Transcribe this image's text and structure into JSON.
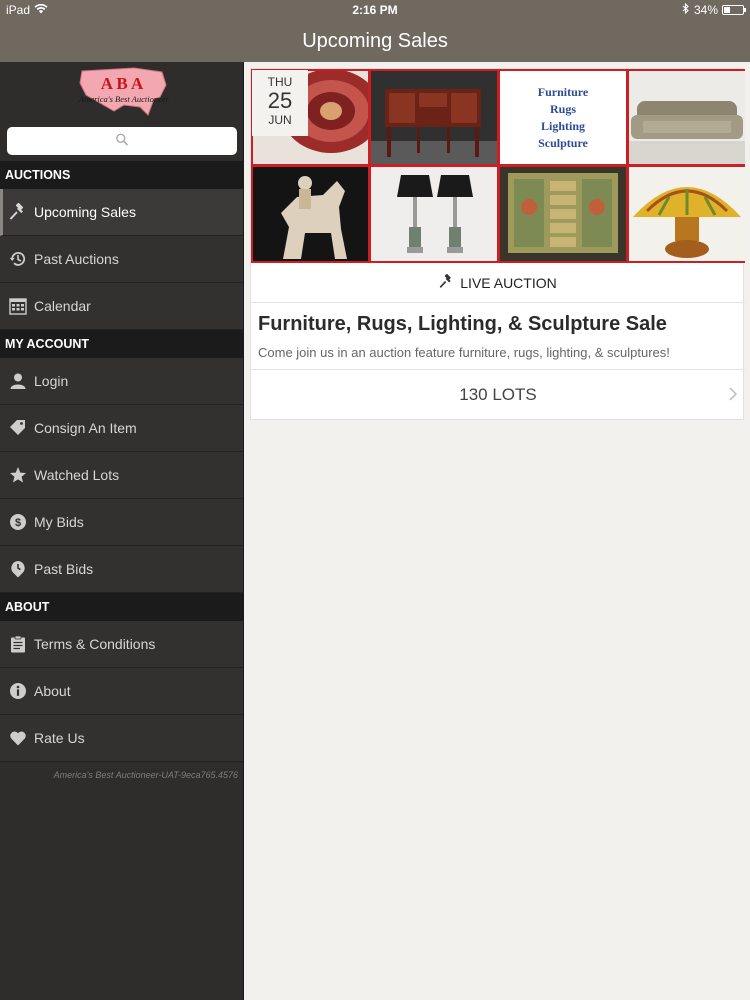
{
  "status_bar": {
    "device": "iPad",
    "time": "2:16 PM",
    "battery": "34%",
    "battery_level": 0.34
  },
  "navbar": {
    "title": "Upcoming Sales"
  },
  "sidebar": {
    "logo": {
      "text": "ABA",
      "subtitle": "America's Best Auctioneer"
    },
    "search": {
      "placeholder": ""
    },
    "sections": [
      {
        "header": "AUCTIONS",
        "items": [
          {
            "label": "Upcoming Sales",
            "icon": "gavel-icon",
            "active": true
          },
          {
            "label": "Past Auctions",
            "icon": "history-icon"
          },
          {
            "label": "Calendar",
            "icon": "calendar-icon"
          }
        ]
      },
      {
        "header": "MY ACCOUNT",
        "items": [
          {
            "label": "Login",
            "icon": "user-icon"
          },
          {
            "label": "Consign An Item",
            "icon": "tag-icon"
          },
          {
            "label": "Watched Lots",
            "icon": "star-icon"
          },
          {
            "label": "My Bids",
            "icon": "dollar-icon"
          },
          {
            "label": "Past Bids",
            "icon": "clock-pin-icon"
          }
        ]
      },
      {
        "header": "ABOUT",
        "items": [
          {
            "label": "Terms & Conditions",
            "icon": "clipboard-icon"
          },
          {
            "label": "About",
            "icon": "info-icon"
          },
          {
            "label": "Rate Us",
            "icon": "heart-icon"
          }
        ]
      }
    ],
    "version": "America's Best Auctioneer-UAT-9eca765.4576"
  },
  "auction": {
    "date": {
      "dow": "THU",
      "day": "25",
      "month": "JUN"
    },
    "collage_text": [
      "Furniture",
      "Rugs",
      "Lighting",
      "Sculpture"
    ],
    "type_label": "LIVE AUCTION",
    "title": "Furniture, Rugs, Lighting, & Sculpture Sale",
    "description": "Come join us in an auction feature furniture, rugs, lighting, & sculptures!",
    "lots": "130 LOTS"
  },
  "colors": {
    "bar": "#6f6960",
    "sidebar": "#2e2d2c",
    "accent_red": "#cc1f24",
    "background": "#f2f1ee"
  }
}
